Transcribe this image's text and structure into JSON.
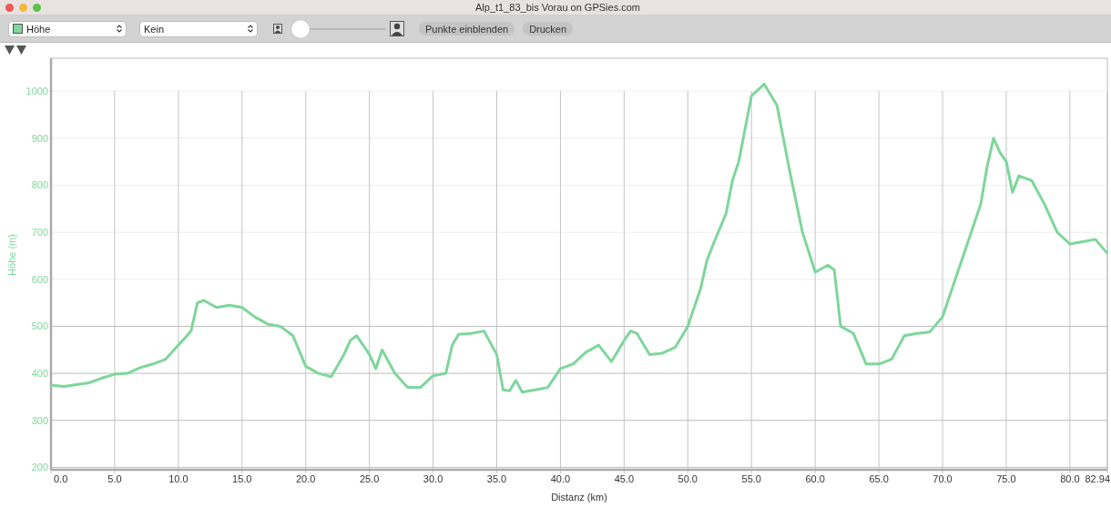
{
  "window": {
    "title": "Alp_t1_83_bis Vorau on GPSies.com"
  },
  "toolbar": {
    "overlay_select": {
      "value": "Kein"
    },
    "zoom_slider": {
      "level": 0
    },
    "buttons": [
      "Punkte einblenden",
      "Drucken"
    ]
  },
  "chart": {
    "chart_data": {
      "type": "line",
      "grid": true,
      "xlabel": "Distanz (km)",
      "ylabel": "Höhe (m)",
      "x": [
        0,
        1,
        2,
        3,
        4,
        5,
        6,
        7,
        8,
        9,
        10,
        10.5,
        11,
        11.5,
        12,
        13,
        14,
        15,
        16,
        17,
        18,
        19,
        20,
        21,
        22,
        23,
        23.5,
        24,
        25,
        25.5,
        26,
        27,
        28,
        29,
        30,
        31,
        31.5,
        32,
        33,
        34,
        35,
        35.5,
        36,
        36.5,
        37,
        38,
        39,
        40,
        41,
        42,
        43,
        44,
        45,
        45.5,
        46,
        47,
        48,
        49,
        50,
        50.5,
        51,
        51.5,
        52,
        53,
        53.5,
        54,
        55,
        56,
        57,
        58,
        59,
        60,
        61,
        61.5,
        62,
        63,
        64,
        65,
        66,
        67,
        68,
        69,
        70,
        71,
        72,
        73,
        73.5,
        74,
        74.5,
        75,
        75.5,
        76,
        77,
        78,
        79,
        80,
        81,
        82,
        82.94
      ],
      "series": [
        {
          "name": "Höhe",
          "color": "#7ed69b",
          "values": [
            375,
            372,
            376,
            380,
            390,
            398,
            400,
            412,
            420,
            430,
            460,
            475,
            490,
            550,
            555,
            540,
            545,
            540,
            520,
            505,
            500,
            480,
            415,
            400,
            393,
            440,
            470,
            480,
            440,
            410,
            450,
            400,
            370,
            370,
            395,
            400,
            460,
            483,
            485,
            490,
            440,
            365,
            363,
            385,
            360,
            365,
            370,
            410,
            420,
            445,
            460,
            425,
            470,
            490,
            485,
            440,
            443,
            455,
            500,
            540,
            580,
            640,
            675,
            740,
            810,
            850,
            990,
            1015,
            970,
            830,
            700,
            615,
            630,
            620,
            500,
            485,
            420,
            420,
            430,
            480,
            485,
            488,
            520,
            600,
            680,
            760,
            840,
            900,
            870,
            850,
            785,
            820,
            810,
            760,
            700,
            675,
            680,
            685,
            655
          ]
        }
      ],
      "xlim": [
        0,
        82.94
      ],
      "ylim": [
        195,
        1070
      ],
      "xticks": [
        {
          "value": 0,
          "label": "0.0"
        },
        {
          "value": 5,
          "label": "5.0"
        },
        {
          "value": 10,
          "label": "10.0"
        },
        {
          "value": 15,
          "label": "15.0"
        },
        {
          "value": 20,
          "label": "20.0"
        },
        {
          "value": 25,
          "label": "25.0"
        },
        {
          "value": 30,
          "label": "30.0"
        },
        {
          "value": 35,
          "label": "35.0"
        },
        {
          "value": 40,
          "label": "40.0"
        },
        {
          "value": 45,
          "label": "45.0"
        },
        {
          "value": 50,
          "label": "50.0"
        },
        {
          "value": 55,
          "label": "55.0"
        },
        {
          "value": 60,
          "label": "60.0"
        },
        {
          "value": 65,
          "label": "65.0"
        },
        {
          "value": 70,
          "label": "70.0"
        },
        {
          "value": 75,
          "label": "75.0"
        },
        {
          "value": 80,
          "label": "80.0"
        },
        {
          "value": 82.94,
          "label": "82.94"
        }
      ],
      "yticks": [
        200,
        300,
        400,
        500,
        600,
        700,
        800,
        900,
        1000
      ]
    }
  }
}
